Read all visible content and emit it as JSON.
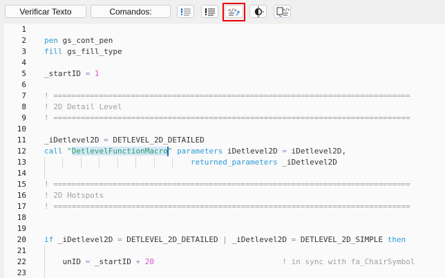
{
  "toolbar": {
    "verify_label": "Verificar Texto",
    "commands_label": "Comandos:",
    "icons": [
      "error-list-icon",
      "warning-list-icon",
      "format-code-icon",
      "theme-toggle-icon",
      "insert-snippet-icon"
    ],
    "highlight_color": "#e00000"
  },
  "editor": {
    "lines": [
      [],
      [
        [
          "kw",
          "pen"
        ],
        [
          "t",
          " gs_cont_pen"
        ]
      ],
      [
        [
          "kw",
          "fill"
        ],
        [
          "t",
          " gs_fill_type"
        ]
      ],
      [],
      [
        [
          "t",
          "_startID "
        ],
        [
          "op",
          "="
        ],
        [
          "t",
          " "
        ],
        [
          "num",
          "1"
        ]
      ],
      [],
      [
        [
          "cm",
          "! =============================================================================="
        ]
      ],
      [
        [
          "cm",
          "! 2D Detail Level"
        ]
      ],
      [
        [
          "cm",
          "! =============================================================================="
        ]
      ],
      [],
      [
        [
          "t",
          "_iDetlevel2D "
        ],
        [
          "op",
          "="
        ],
        [
          "t",
          " DETLEVEL_2D_DETAILED"
        ]
      ],
      [
        [
          "kw",
          "call"
        ],
        [
          "t",
          " "
        ],
        [
          "str",
          "\""
        ],
        [
          "sel",
          "DetlevelFunctionMacro"
        ],
        [
          "caret",
          ""
        ],
        [
          "str",
          "\""
        ],
        [
          "t",
          " "
        ],
        [
          "kw",
          "parameters"
        ],
        [
          "t",
          " iDetlevel2D "
        ],
        [
          "op",
          "="
        ],
        [
          "t",
          " iDetlevel2D,"
        ]
      ],
      [
        [
          "t",
          "                                "
        ],
        [
          "kw",
          "returned_parameters"
        ],
        [
          "t",
          " _iDetlevel2D"
        ]
      ],
      [],
      [
        [
          "cm",
          "! =============================================================================="
        ]
      ],
      [
        [
          "cm",
          "! 2D Hotspots"
        ]
      ],
      [
        [
          "cm",
          "! =============================================================================="
        ]
      ],
      [],
      [],
      [
        [
          "kw",
          "if"
        ],
        [
          "t",
          " _iDetlevel2D "
        ],
        [
          "op",
          "="
        ],
        [
          "t",
          " DETLEVEL_2D_DETAILED "
        ],
        [
          "op",
          "|"
        ],
        [
          "t",
          " _iDetlevel2D "
        ],
        [
          "op",
          "="
        ],
        [
          "t",
          " DETLEVEL_2D_SIMPLE "
        ],
        [
          "kw",
          "then"
        ]
      ],
      [],
      [
        [
          "t",
          "    unID "
        ],
        [
          "op",
          "="
        ],
        [
          "t",
          " _startID "
        ],
        [
          "op",
          "+"
        ],
        [
          "t",
          " "
        ],
        [
          "num",
          "20"
        ],
        [
          "t",
          "                            "
        ],
        [
          "cm",
          "! in sync with fa_ChairSymbol"
        ]
      ],
      []
    ]
  }
}
